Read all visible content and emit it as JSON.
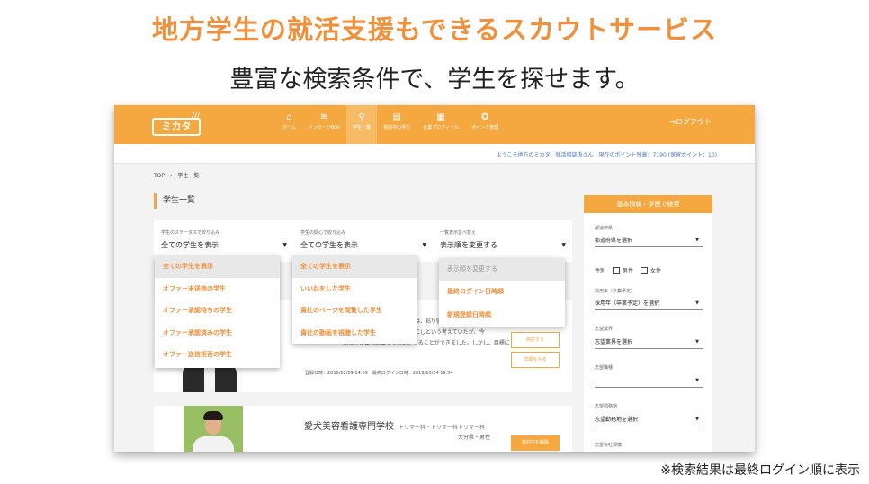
{
  "headline": "地方学生の就活支援もできるスカウトサービス",
  "subheadline": "豊富な検索条件で、学生を探せます。",
  "footnote": "※検索結果は最終ログイン順に表示",
  "colors": {
    "accent": "#f5a840",
    "headline": "#f0903a",
    "link": "#4a78c0"
  },
  "app": {
    "logo_text": "ミカタ",
    "logout": "ログアウト",
    "nav": [
      {
        "icon": "home-icon",
        "glyph": "⌂",
        "label": "ホーム"
      },
      {
        "icon": "mail-icon",
        "glyph": "✉",
        "label": "メッセージBOX"
      },
      {
        "icon": "search-icon",
        "glyph": "⚲",
        "label": "学生一覧"
      },
      {
        "icon": "document-icon",
        "glyph": "▤",
        "label": "検討中の学生"
      },
      {
        "icon": "building-icon",
        "glyph": "▦",
        "label": "企業プロフィール"
      },
      {
        "icon": "points-icon",
        "glyph": "✪",
        "label": "ポイント管理"
      }
    ],
    "welcome": "ようこそ地方のミカタ　就活相談係さん　現在のポイント残高：7190 (保留ポイント：10)"
  },
  "breadcrumb": "TOP　›　学生一覧",
  "page_title": "学生一覧",
  "filters": [
    {
      "label": "学生のステータスで絞り込み",
      "value": "全ての学生を表示"
    },
    {
      "label": "学生の関心で絞り込み",
      "value": "全ての学生を表示"
    },
    {
      "label": "一覧表示並べ替え",
      "value": "表示順を変更する"
    }
  ],
  "dropdowns": {
    "status": [
      "全ての学生を表示",
      "オファー未送信の学生",
      "オファー承認待ちの学生",
      "オファー承認済みの学生",
      "オファー送信拒否の学生"
    ],
    "interest": [
      "全ての学生を表示",
      "いいねをした学生",
      "貴社のページを閲覧した学生",
      "貴社の動画を視聴した学生"
    ],
    "sort": [
      "表示順を変更する",
      "最終ログイン日時順",
      "新規登録日時順"
    ]
  },
  "cards": [
    {
      "text_lines": [
        "は、粘り強い",
        "にしという考えていたが、今",
        "は相手の立場に立って行動をすることができました。しかし、目標に"
      ],
      "date": "登録日時：2018/02/09 14:09　最終ログイン日時：2018/10/24 19:54",
      "btn_1": "検討する",
      "btn_2": "詳細をみる"
    },
    {
      "school": "愛犬美容看護専門学校",
      "dept": "トリマー科・トリマー科トリマー科",
      "location": "大分県・男性",
      "btn": "検討中を解除"
    }
  ],
  "sidebar": {
    "title": "基本情報・学歴で検索",
    "prefecture_label": "都道府県",
    "prefecture": "都道府県を選択",
    "gender_label": "性別",
    "gender_male": "男性",
    "gender_female": "女性",
    "year_label": "採用年（卒業予定）",
    "year": "採用年（卒業予定）を選択",
    "industry_label": "志望業界",
    "industry": "志望業界を選択",
    "job_label": "志望職種",
    "area_label": "志望勤務地",
    "area": "志望勤務地を選択",
    "company_label": "志望会社規模"
  }
}
